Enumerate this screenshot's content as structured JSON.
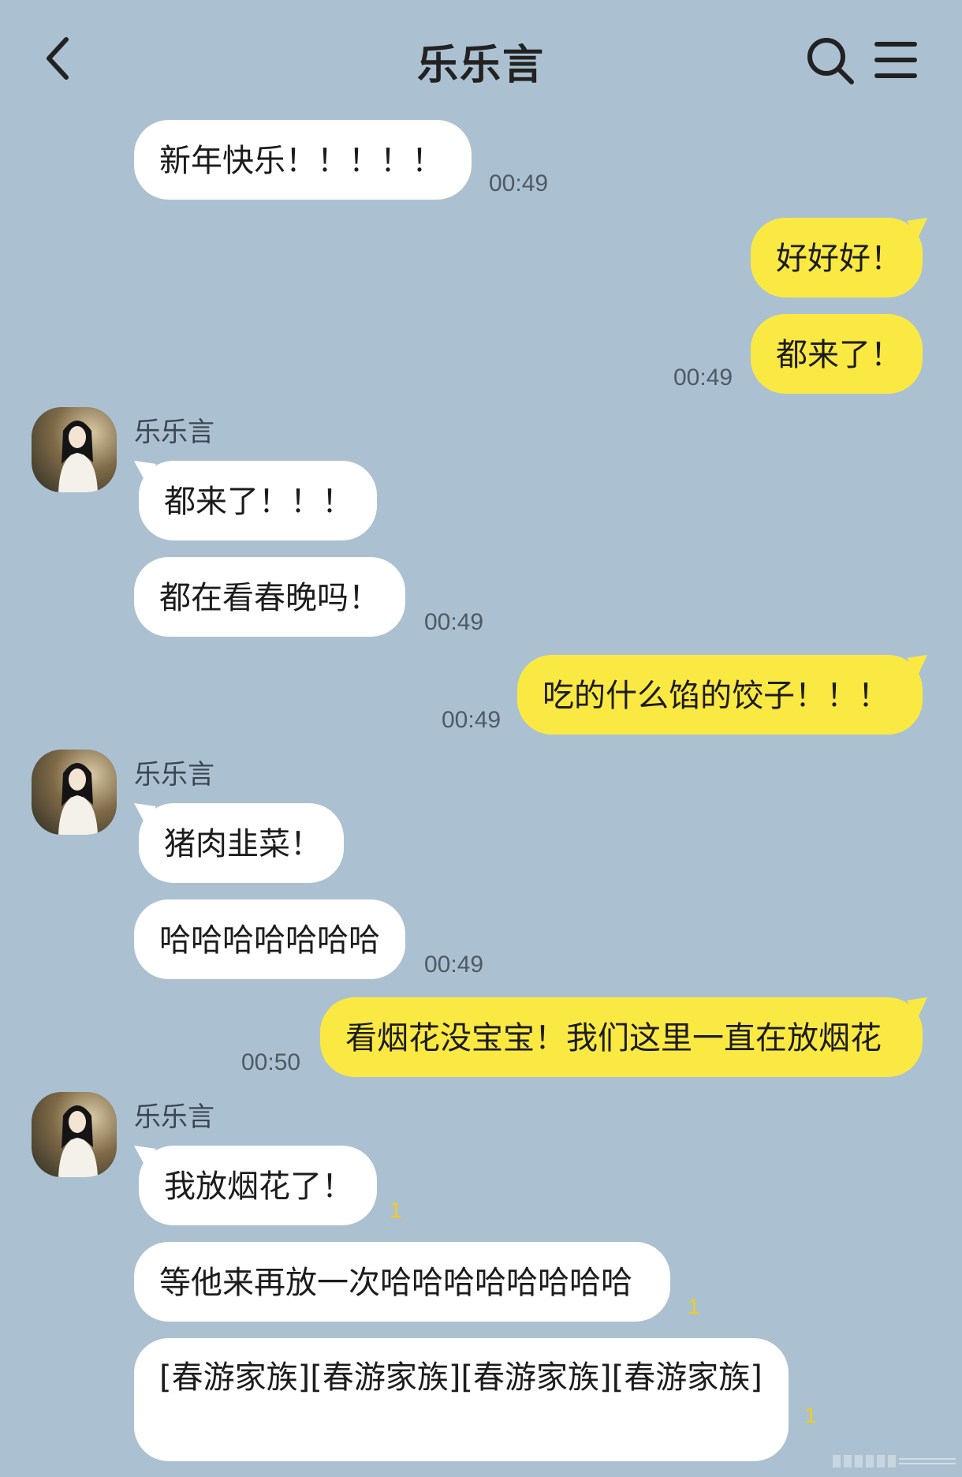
{
  "header": {
    "back_icon": "back-arrow-icon",
    "title": "乐乐言",
    "search_icon": "search-icon",
    "menu_icon": "menu-icon"
  },
  "colors": {
    "background": "#abc1d2",
    "incoming_bubble": "#ffffff",
    "outgoing_bubble": "#fbe943",
    "unread_count": "#f2cc1c"
  },
  "messages": [
    {
      "direction": "in",
      "text": "新年快乐！！！！！",
      "time": "00:49"
    },
    {
      "direction": "out",
      "text": "好好好！"
    },
    {
      "direction": "out",
      "text": "都来了！",
      "time": "00:49"
    },
    {
      "direction": "in",
      "sender": "乐乐言",
      "text": "都来了！！！"
    },
    {
      "direction": "in",
      "text": "都在看春晚吗！",
      "time": "00:49"
    },
    {
      "direction": "out",
      "text": "吃的什么馅的饺子！！！",
      "time": "00:49"
    },
    {
      "direction": "in",
      "sender": "乐乐言",
      "text": "猪肉韭菜！"
    },
    {
      "direction": "in",
      "text": "哈哈哈哈哈哈哈",
      "time": "00:49"
    },
    {
      "direction": "out",
      "text": "看烟花没宝宝！我们这里一直在放烟花",
      "time": "00:50"
    },
    {
      "direction": "in",
      "sender": "乐乐言",
      "text": "我放烟花了！",
      "unread": "1"
    },
    {
      "direction": "in",
      "text": "等他来再放一次哈哈哈哈哈哈哈哈",
      "unread": "1"
    },
    {
      "direction": "in",
      "text": "[春游家族][春游家族][春游家族][春游家族]",
      "unread": "1"
    }
  ]
}
